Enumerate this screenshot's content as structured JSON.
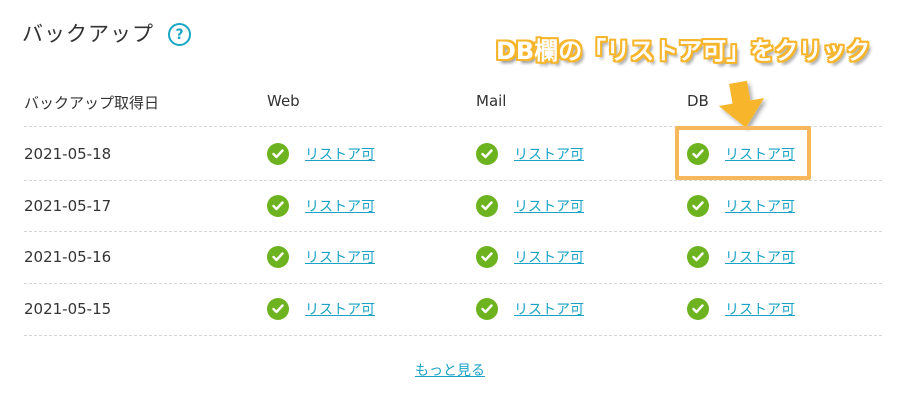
{
  "section": {
    "title": "バックアップ",
    "help_symbol": "?"
  },
  "annotation": {
    "text": "DB欄の「リストア可」をクリック",
    "color": "#f6b52a"
  },
  "table": {
    "headers": {
      "date": "バックアップ取得日",
      "web": "Web",
      "mail": "Mail",
      "db": "DB"
    },
    "rows": [
      {
        "date": "2021-05-18",
        "web": "リストア可",
        "mail": "リストア可",
        "db": "リストア可"
      },
      {
        "date": "2021-05-17",
        "web": "リストア可",
        "mail": "リストア可",
        "db": "リストア可"
      },
      {
        "date": "2021-05-16",
        "web": "リストア可",
        "mail": "リストア可",
        "db": "リストア可"
      },
      {
        "date": "2021-05-15",
        "web": "リストア可",
        "mail": "リストア可",
        "db": "リストア可"
      }
    ]
  },
  "more_link": "もっと見る",
  "colors": {
    "link": "#1aa3c6",
    "check": "#6db31f",
    "highlight": "#f6b85a"
  }
}
